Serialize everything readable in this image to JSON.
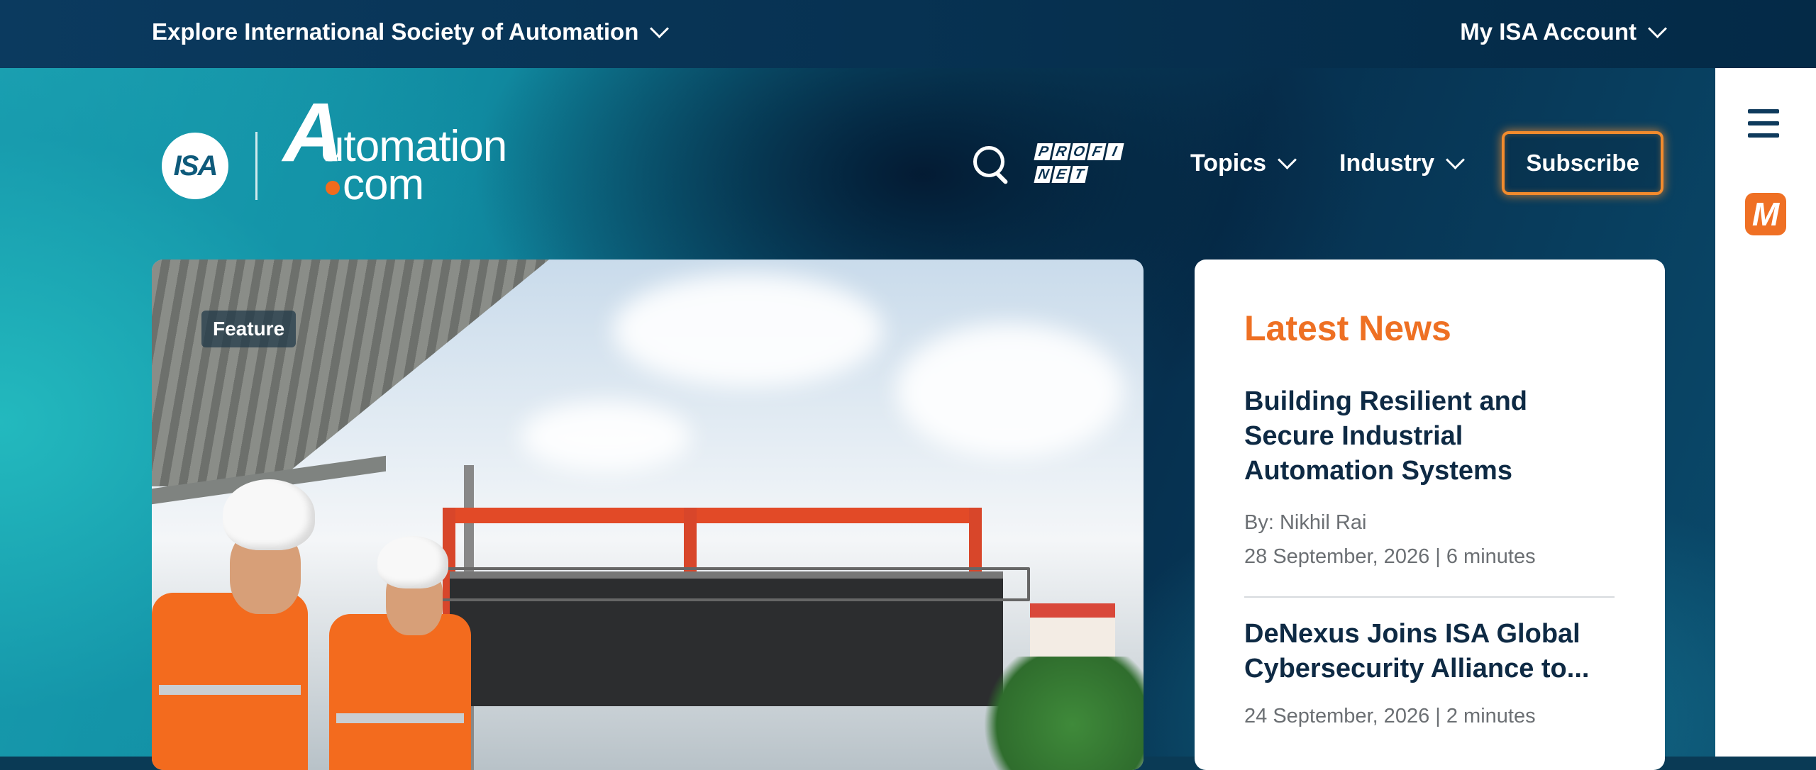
{
  "topbar": {
    "explore_label": "Explore International Society of Automation",
    "account_label": "My ISA Account"
  },
  "logo": {
    "isa_text": "ISA",
    "automation_first": "A",
    "automation_rest": "utomation",
    "dotcom": "com"
  },
  "nav": {
    "profinet_row1": [
      "P",
      "R",
      "O",
      "F",
      "I"
    ],
    "profinet_row2": [
      "N",
      "E",
      "T"
    ],
    "topics_label": "Topics",
    "industry_label": "Industry",
    "subscribe_label": "Subscribe"
  },
  "feature": {
    "badge": "Feature"
  },
  "latest_news": {
    "heading": "Latest News",
    "items": [
      {
        "title": "Building Resilient and Secure Industrial Automation Systems",
        "author": "By: Nikhil Rai",
        "meta": "28 September, 2026 | 6 minutes"
      },
      {
        "title": "DeNexus Joins ISA Global Cybersecurity Alliance to...",
        "meta": "24 September, 2026 | 2 minutes"
      }
    ]
  },
  "side_rail": {
    "m_label": "M"
  },
  "colors": {
    "accent_orange": "#ee7023",
    "navy": "#06304f",
    "teal": "#1ea6b5"
  }
}
